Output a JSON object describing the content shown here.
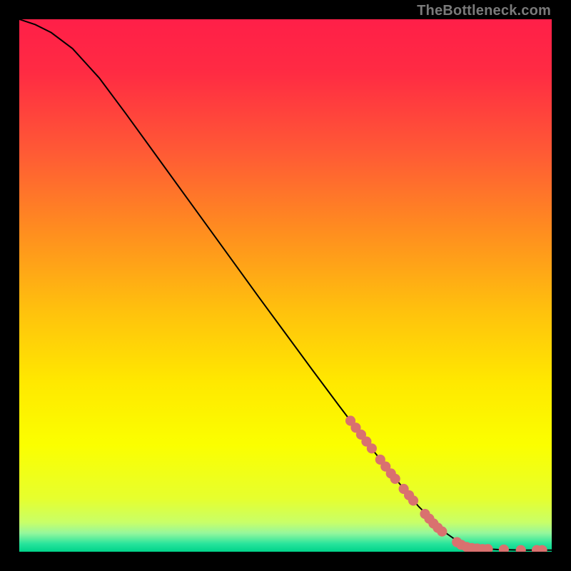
{
  "attribution": "TheBottleneck.com",
  "chart_data": {
    "type": "line",
    "title": "",
    "xlabel": "",
    "ylabel": "",
    "xlim": [
      0,
      100
    ],
    "ylim": [
      0,
      100
    ],
    "background_gradient_stops": [
      {
        "offset": 0.0,
        "color": "#ff1f48"
      },
      {
        "offset": 0.1,
        "color": "#ff2b43"
      },
      {
        "offset": 0.25,
        "color": "#ff5a35"
      },
      {
        "offset": 0.4,
        "color": "#ff8e1f"
      },
      {
        "offset": 0.55,
        "color": "#ffc20d"
      },
      {
        "offset": 0.68,
        "color": "#ffe800"
      },
      {
        "offset": 0.8,
        "color": "#fbff00"
      },
      {
        "offset": 0.9,
        "color": "#e6ff2e"
      },
      {
        "offset": 0.945,
        "color": "#c8ff68"
      },
      {
        "offset": 0.965,
        "color": "#95f79c"
      },
      {
        "offset": 0.985,
        "color": "#28e49c"
      },
      {
        "offset": 1.0,
        "color": "#00d38a"
      }
    ],
    "series": [
      {
        "name": "bottleneck-curve",
        "color": "#000000",
        "points": [
          {
            "x": 0.0,
            "y": 100.0
          },
          {
            "x": 3.0,
            "y": 99.0
          },
          {
            "x": 6.0,
            "y": 97.5
          },
          {
            "x": 10.0,
            "y": 94.5
          },
          {
            "x": 15.0,
            "y": 89.0
          },
          {
            "x": 20.0,
            "y": 82.3
          },
          {
            "x": 25.0,
            "y": 75.4
          },
          {
            "x": 30.0,
            "y": 68.5
          },
          {
            "x": 35.0,
            "y": 61.6
          },
          {
            "x": 40.0,
            "y": 54.7
          },
          {
            "x": 45.0,
            "y": 47.8
          },
          {
            "x": 50.0,
            "y": 41.0
          },
          {
            "x": 55.0,
            "y": 34.2
          },
          {
            "x": 60.0,
            "y": 27.5
          },
          {
            "x": 65.0,
            "y": 20.9
          },
          {
            "x": 70.0,
            "y": 14.5
          },
          {
            "x": 75.0,
            "y": 8.5
          },
          {
            "x": 80.0,
            "y": 3.6
          },
          {
            "x": 83.0,
            "y": 1.5
          },
          {
            "x": 85.0,
            "y": 0.7
          },
          {
            "x": 90.0,
            "y": 0.4
          },
          {
            "x": 95.0,
            "y": 0.3
          },
          {
            "x": 100.0,
            "y": 0.3
          }
        ]
      }
    ],
    "markers": {
      "name": "highlighted-segment",
      "color": "#d9716f",
      "radius_frac": 0.0095,
      "points": [
        {
          "x": 62.2,
          "y": 24.6
        },
        {
          "x": 63.2,
          "y": 23.3
        },
        {
          "x": 64.2,
          "y": 22.0
        },
        {
          "x": 65.2,
          "y": 20.7
        },
        {
          "x": 66.2,
          "y": 19.4
        },
        {
          "x": 67.8,
          "y": 17.3
        },
        {
          "x": 68.8,
          "y": 16.0
        },
        {
          "x": 69.8,
          "y": 14.7
        },
        {
          "x": 70.6,
          "y": 13.7
        },
        {
          "x": 72.2,
          "y": 11.8
        },
        {
          "x": 73.2,
          "y": 10.6
        },
        {
          "x": 74.0,
          "y": 9.6
        },
        {
          "x": 76.2,
          "y": 7.1
        },
        {
          "x": 77.0,
          "y": 6.2
        },
        {
          "x": 77.8,
          "y": 5.3
        },
        {
          "x": 78.6,
          "y": 4.5
        },
        {
          "x": 79.4,
          "y": 3.8
        },
        {
          "x": 82.2,
          "y": 1.8
        },
        {
          "x": 83.0,
          "y": 1.3
        },
        {
          "x": 84.0,
          "y": 0.9
        },
        {
          "x": 85.0,
          "y": 0.7
        },
        {
          "x": 86.0,
          "y": 0.6
        },
        {
          "x": 87.0,
          "y": 0.5
        },
        {
          "x": 88.0,
          "y": 0.5
        },
        {
          "x": 91.0,
          "y": 0.4
        },
        {
          "x": 94.2,
          "y": 0.3
        },
        {
          "x": 97.2,
          "y": 0.3
        },
        {
          "x": 98.2,
          "y": 0.3
        }
      ]
    }
  }
}
